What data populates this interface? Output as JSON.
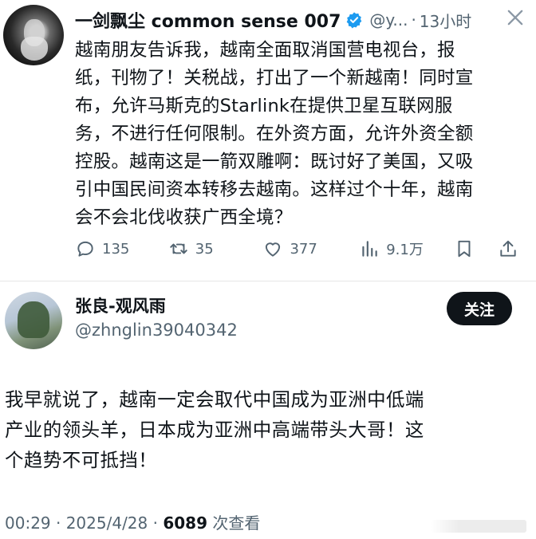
{
  "quoted_post": {
    "author_name": "一剑飘尘 common sense 007",
    "handle": "@y...",
    "separator": "·",
    "time": "13小时",
    "text_lines": [
      "越南朋友告诉我，越南全面取消国营电视台，报",
      "纸，刊物了！关税战，打出了一个新越南！同时宣",
      "布，允许马斯克的Starlink在提供卫星互联网服",
      "务，不进行任何限制。在外资方面，允许外资全额",
      "控股。越南这是一箭双雕啊：既讨好了美国，又吸",
      "引中国民间资本转移去越南。这样过个十年，越南",
      "会不会北伐收获广西全境？"
    ],
    "actions": {
      "replies": "135",
      "reposts": "35",
      "likes": "377",
      "views": "9.1万"
    },
    "verified_color": "#1d9bf0"
  },
  "post": {
    "author_name": "张良-观风雨",
    "handle": "@zhnglin39040342",
    "follow_label": "关注",
    "text_lines": [
      "我早就说了，越南一定会取代中国成为亚洲中低端",
      "产业的领头羊，日本成为亚洲中高端带头大哥！这",
      "个趋势不可抵挡！"
    ],
    "timestamp": "00:29 · 2025/4/28 · ",
    "views_count": "6089",
    "views_label": " 次查看"
  }
}
